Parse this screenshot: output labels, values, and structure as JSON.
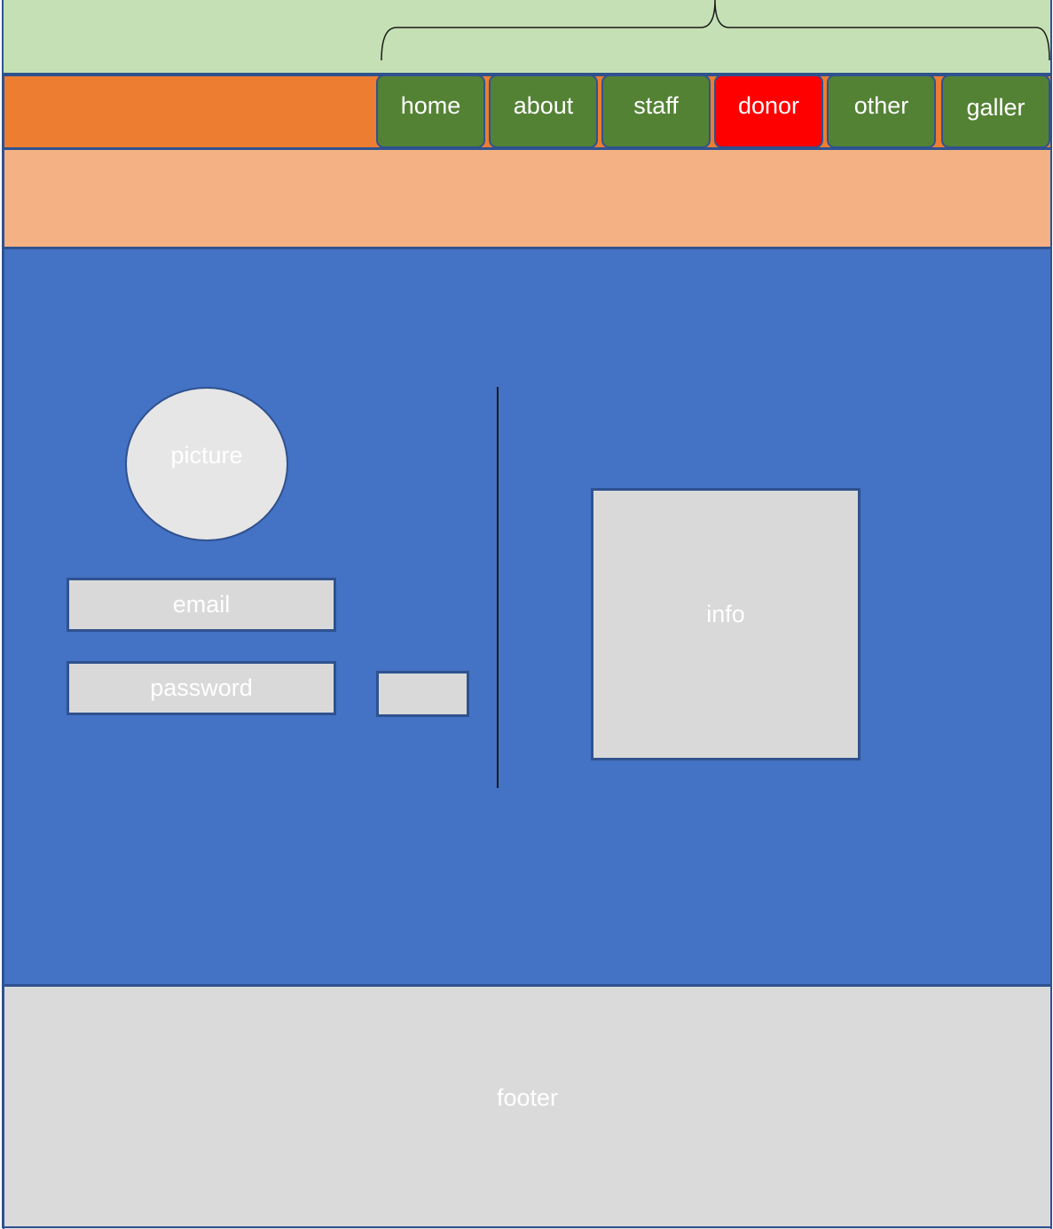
{
  "colors": {
    "top_band": "#c5e0b4",
    "nav_bar": "#ed7d31",
    "nav_button": "#548235",
    "nav_button_active": "#ff0000",
    "banner": "#f4b183",
    "main": "#4472c4",
    "panel": "#d9d9d9",
    "outline": "#2f528f",
    "text": "#ffffff"
  },
  "nav": {
    "items": [
      {
        "label": "home",
        "active": false
      },
      {
        "label": "about",
        "active": false
      },
      {
        "label": "staff",
        "active": false
      },
      {
        "label": "donor",
        "active": true
      },
      {
        "label": "other",
        "active": false
      },
      {
        "label": "galler",
        "active": false
      }
    ]
  },
  "profile": {
    "picture_label": "picture",
    "email_label": "email",
    "password_label": "password"
  },
  "info": {
    "label": "info"
  },
  "footer": {
    "label": "footer"
  }
}
